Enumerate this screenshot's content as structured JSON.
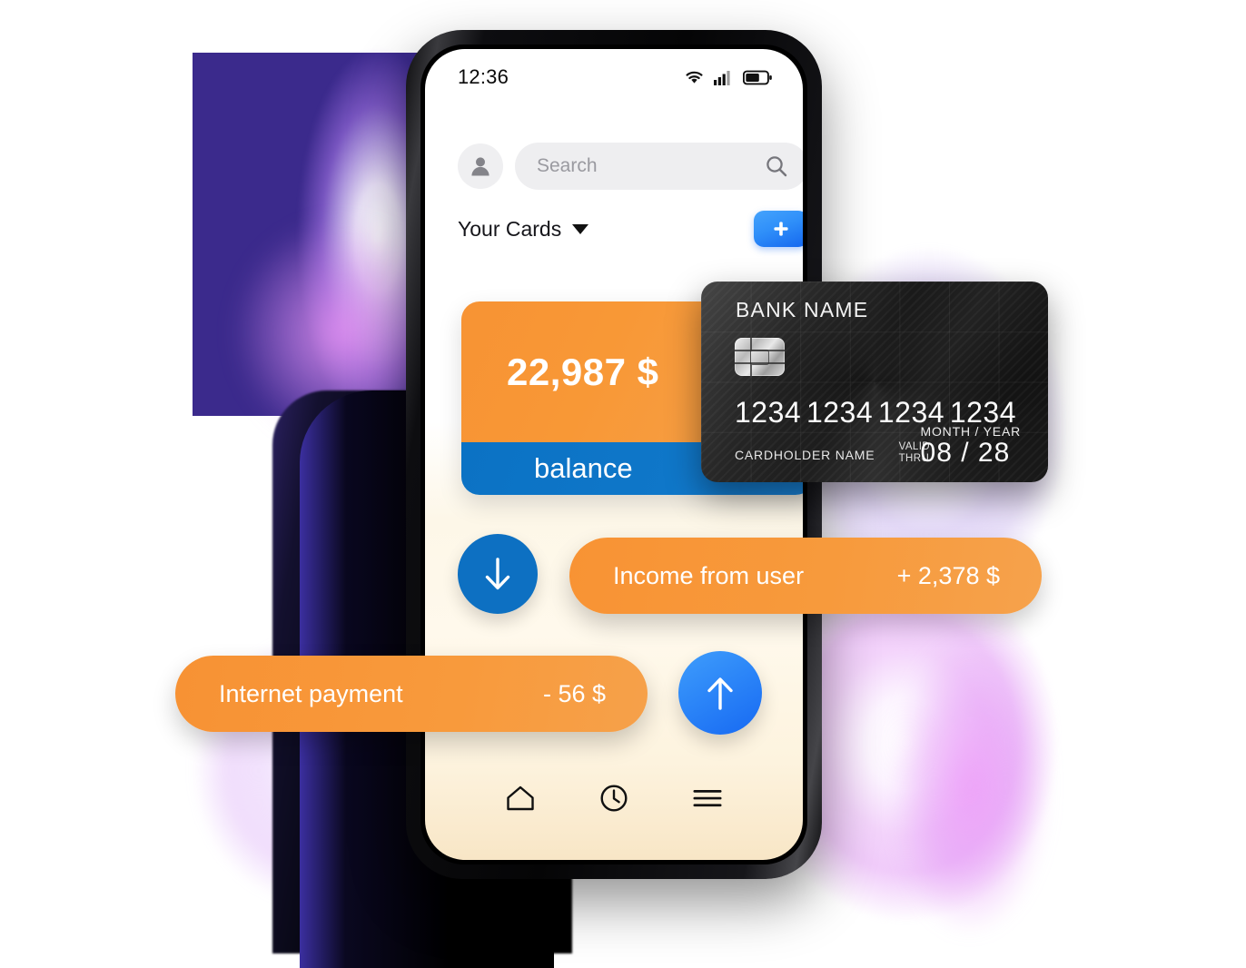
{
  "statusbar": {
    "time": "12:36",
    "icons": [
      "wifi-icon",
      "cellular-signal-icon",
      "battery-icon"
    ]
  },
  "header": {
    "avatar_icon": "user-avatar-icon",
    "search": {
      "placeholder": "Search",
      "value": "",
      "icon": "search-icon"
    },
    "section_title": "Your Cards",
    "dropdown_icon": "chevron-down-icon",
    "add_button_label": "+",
    "add_button_icon": "plus-icon"
  },
  "balance_card": {
    "amount": "22,987 $",
    "label": "balance",
    "top_color": "#f79334",
    "bottom_color": "#0f77c9"
  },
  "credit_card": {
    "bank_name": "BANK  NAME",
    "chip_icon": "card-chip-icon",
    "number_groups": [
      "1234",
      "1234",
      "1234",
      "1234"
    ],
    "cardholder_label": "CARDHOLDER NAME",
    "valid_line1": "VALID",
    "valid_line2": "THRU",
    "expiry_label": "MONTH / YEAR",
    "expiry_value": "08 / 28"
  },
  "transactions": [
    {
      "label": "Income from user",
      "amount": "+ 2,378 $",
      "icon": "arrow-down-icon",
      "direction": "incoming",
      "icon_color": "#0d70c2"
    },
    {
      "label": "Internet payment",
      "amount": "- 56 $",
      "icon": "arrow-up-icon",
      "direction": "outgoing",
      "icon_color": "#2c86f8"
    }
  ],
  "bottom_nav": [
    {
      "icon": "home-icon",
      "label": "Home"
    },
    {
      "icon": "clock-icon",
      "label": "History"
    },
    {
      "icon": "menu-icon",
      "label": "Menu"
    }
  ],
  "theme": {
    "accent_orange": "#f89334",
    "accent_blue": "#0f77c9",
    "bright_blue": "#2c86f8",
    "background_purple": "#3b2a8c"
  }
}
